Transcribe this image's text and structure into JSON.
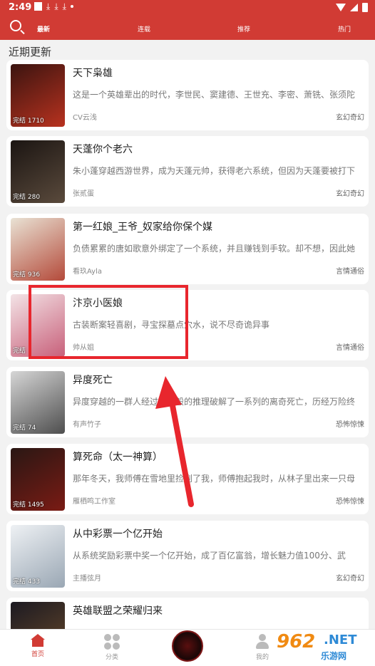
{
  "status_bar": {
    "time": "2:49"
  },
  "top_tabs": [
    "最新",
    "连载",
    "推荐",
    "热门"
  ],
  "section_title": "近期更新",
  "books": [
    {
      "title": "天下枭雄",
      "desc": "这是一个英雄辈出的时代，李世民、窦建德、王世充、李密、萧铣、张须陀",
      "author": "CV云浅",
      "genre": "玄幻奇幻",
      "badge": "完结 1710",
      "cover_colors": [
        "#3b1410",
        "#b8321f"
      ]
    },
    {
      "title": "天蓬你个老六",
      "desc": "朱小蓬穿越西游世界，成为天蓬元帅，获得老六系统，但因为天蓬要被打下",
      "author": "张贰蛋",
      "genre": "玄幻奇幻",
      "badge": "完结 280",
      "cover_colors": [
        "#1b1512",
        "#5a4a3c"
      ]
    },
    {
      "title": "第一红娘_王爷_奴家给你保个媒",
      "desc": "负债累累的唐如歌意外绑定了一个系统，并且赚钱到手软。却不想，因此她",
      "author": "看玖Ayla",
      "genre": "言情通俗",
      "badge": "完结 936",
      "cover_colors": [
        "#e9e2d4",
        "#b44a3a"
      ]
    },
    {
      "title": "汴京小医娘",
      "desc": "古装断案轻喜剧，寻宝探墓点穴水，说不尽奇诡异事",
      "author": "帅从姐",
      "genre": "言情通俗",
      "badge": "完结",
      "cover_colors": [
        "#f3e3e6",
        "#c8607a"
      ]
    },
    {
      "title": "异度死亡",
      "desc": "异度穿越的一群人经过天才般的推理破解了一系列的离奇死亡，历经万险终",
      "author": "有声竹子",
      "genre": "恐怖惊悚",
      "badge": "完结 74",
      "cover_colors": [
        "#d6d6d6",
        "#4e4e4e"
      ]
    },
    {
      "title": "算死命（太一神算）",
      "desc": "那年冬天，我师傅在雪地里捡到了我，师傅抱起我时，从林子里出来一只母",
      "author": "雁栖鸣工作室",
      "genre": "恐怖惊悚",
      "badge": "完结 1495",
      "cover_colors": [
        "#2a1714",
        "#7a1b14"
      ]
    },
    {
      "title": "从中彩票一个亿开始",
      "desc": "从系统奖励彩票中奖一个亿开始，成了百亿富翁，增长魅力值100分、武",
      "author": "主播弦月",
      "genre": "玄幻奇幻",
      "badge": "完结 433",
      "cover_colors": [
        "#eef1f4",
        "#9aa7b4"
      ]
    },
    {
      "title": "英雄联盟之荣耀归来",
      "desc": "",
      "author": "",
      "genre": "",
      "badge": "",
      "cover_colors": [
        "#1c1a22",
        "#6a4a2a"
      ]
    }
  ],
  "bottom_tabs": [
    "首页",
    "分类",
    "我的"
  ],
  "watermark": {
    "number": "962",
    "suffix": ".NET",
    "sub": "乐游网"
  },
  "colors": {
    "brand": "#d13b34",
    "annotation": "#e8262d"
  }
}
